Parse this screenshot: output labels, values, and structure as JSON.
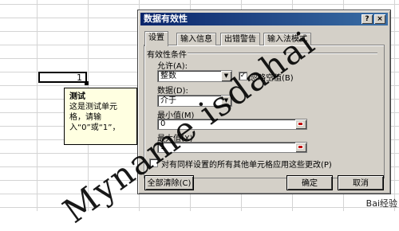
{
  "sheet": {
    "active_cell_value": "1",
    "input_message": {
      "title": "测试",
      "body": "这是测试单元格，请输入“0”或“1”，"
    }
  },
  "dialog": {
    "title": "数据有效性",
    "help": "?",
    "close": "×",
    "tabs": [
      "设置",
      "输入信息",
      "出错警告",
      "输入法模式"
    ],
    "active_tab": "设置",
    "group_label": "有效性条件",
    "allow_label": "允许(A):",
    "allow_value": "整数",
    "ignore_blank_label": "忽略空值(B)",
    "ignore_blank_checked": "✓",
    "data_label": "数据(D):",
    "data_value": "介于",
    "min_label": "最小值(M)",
    "min_value": "0",
    "max_label": "最大值(X)",
    "max_value": "1",
    "apply_all_label": "对有同样设置的所有其他单元格应用这些更改(P)",
    "clear_all_button": "全部清除(C)",
    "ok_button": "确定",
    "cancel_button": "取消"
  },
  "watermark": "Myname isdahai",
  "brand": "Bai经验"
}
